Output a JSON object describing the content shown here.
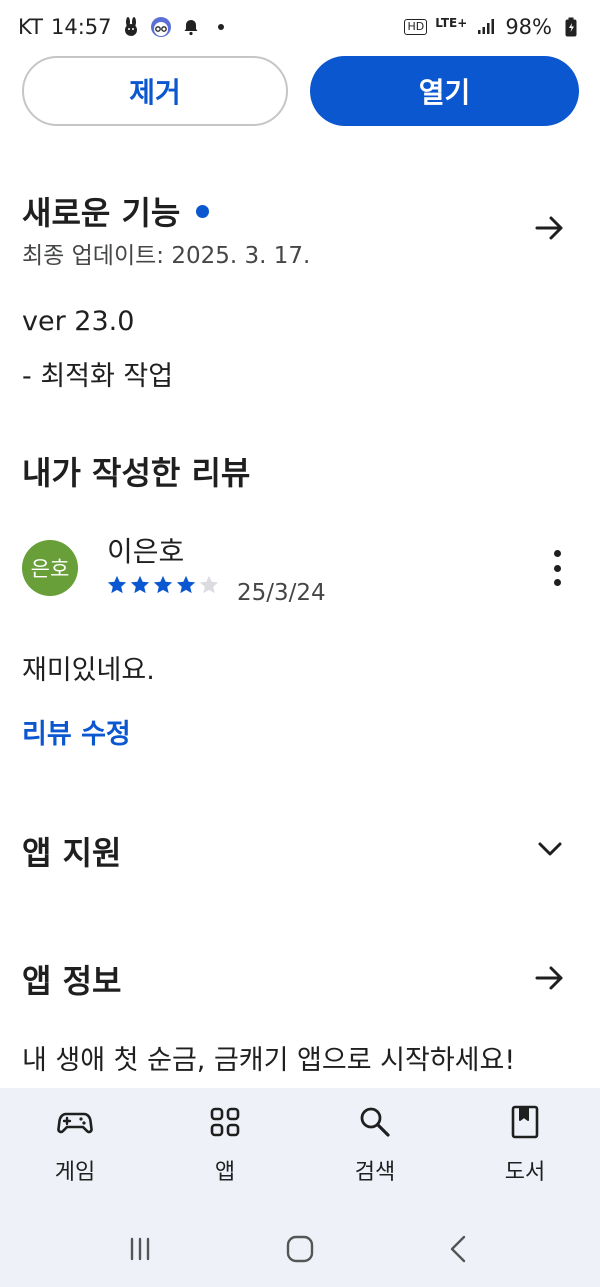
{
  "status_bar": {
    "carrier": "KT",
    "time": "14:57",
    "hd": "HD",
    "lte": "LTE+",
    "battery": "98%"
  },
  "actions": {
    "remove_label": "제거",
    "open_label": "열기"
  },
  "whats_new": {
    "title": "새로운 기능",
    "updated": "최종 업데이트: 2025. 3. 17.",
    "version": "ver 23.0",
    "note": "- 최적화 작업"
  },
  "my_review": {
    "title": "내가 작성한 리뷰",
    "avatar_text": "은호",
    "avatar_color": "#689f38",
    "reviewer_name": "이은호",
    "rating": 4,
    "max_rating": 5,
    "date": "25/3/24",
    "text": "재미있네요.",
    "edit_label": "리뷰 수정"
  },
  "app_support": {
    "title": "앱 지원"
  },
  "app_info": {
    "title": "앱 정보",
    "description": "내 생애 첫 순금, 금캐기 앱으로 시작하세요!"
  },
  "bottom_nav": {
    "items": [
      {
        "label": "게임",
        "icon": "gamepad-icon"
      },
      {
        "label": "앱",
        "icon": "apps-grid-icon"
      },
      {
        "label": "검색",
        "icon": "search-icon"
      },
      {
        "label": "도서",
        "icon": "book-icon"
      }
    ]
  },
  "colors": {
    "accent": "#0b57d0",
    "nav_background": "#eef2f8"
  }
}
